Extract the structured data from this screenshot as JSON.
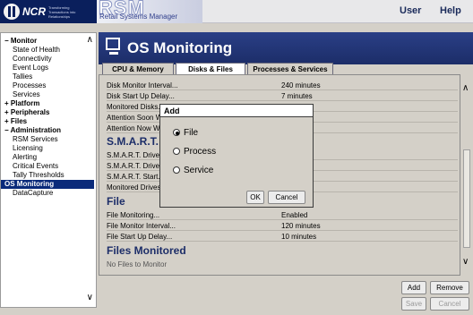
{
  "header": {
    "logo_text": "NCR",
    "logo_tagline": "Transforming Transactions into Relationships",
    "product_short": "RSM",
    "product_name": "Retail Systems Manager",
    "user_link": "User",
    "help_link": "Help"
  },
  "sidebar": {
    "items": [
      {
        "label": "− Monitor",
        "kind": "section"
      },
      {
        "label": "State of Health",
        "kind": "sub"
      },
      {
        "label": "Connectivity",
        "kind": "sub"
      },
      {
        "label": "Event Logs",
        "kind": "sub"
      },
      {
        "label": "Tallies",
        "kind": "sub"
      },
      {
        "label": "Processes",
        "kind": "sub"
      },
      {
        "label": "Services",
        "kind": "sub"
      },
      {
        "label": "+ Platform",
        "kind": "section"
      },
      {
        "label": "+ Peripherals",
        "kind": "section"
      },
      {
        "label": "+ Files",
        "kind": "section"
      },
      {
        "label": "− Administration",
        "kind": "section"
      },
      {
        "label": "RSM Services",
        "kind": "sub"
      },
      {
        "label": "Licensing",
        "kind": "sub"
      },
      {
        "label": "Alerting",
        "kind": "sub"
      },
      {
        "label": "Critical Events",
        "kind": "sub"
      },
      {
        "label": "Tally Thresholds",
        "kind": "sub"
      },
      {
        "label": "OS Monitoring",
        "kind": "selected"
      },
      {
        "label": "DataCapture",
        "kind": "sub"
      }
    ]
  },
  "main": {
    "title": "OS Monitoring",
    "tabs": [
      {
        "label": "CPU & Memory"
      },
      {
        "label": "Disks & Files"
      },
      {
        "label": "Processes & Services"
      }
    ],
    "rows_top": [
      {
        "label": "Disk Monitor Interval...",
        "value": "240 minutes"
      },
      {
        "label": "Disk Start Up Delay...",
        "value": "7 minutes"
      },
      {
        "label": "Monitored Disks...",
        "value": ""
      },
      {
        "label": "Attention Soon W...",
        "value": ""
      },
      {
        "label": "Attention Now W...",
        "value": ""
      }
    ],
    "smart_heading": "S.M.A.R.T.",
    "smart_rows": [
      {
        "label": "S.M.A.R.T. Drive...",
        "value": ""
      },
      {
        "label": "S.M.A.R.T. Drive...",
        "value": "es"
      },
      {
        "label": "S.M.A.R.T. Start...",
        "value": ""
      },
      {
        "label": "Monitored Drives...",
        "value": ""
      }
    ],
    "file_heading": "File",
    "file_rows": [
      {
        "label": "File Monitoring...",
        "value": "Enabled"
      },
      {
        "label": "File Monitor Interval...",
        "value": "120 minutes"
      },
      {
        "label": "File Start Up Delay...",
        "value": "10 minutes"
      }
    ],
    "files_monitored_heading": "Files Monitored",
    "no_files_text": "No Files to Monitor"
  },
  "buttons": {
    "add": "Add",
    "remove": "Remove",
    "save": "Save",
    "cancel": "Cancel"
  },
  "modal": {
    "title": "Add",
    "options": [
      {
        "label": "File",
        "selected": true
      },
      {
        "label": "Process",
        "selected": false
      },
      {
        "label": "Service",
        "selected": false
      }
    ],
    "ok": "OK",
    "cancel": "Cancel"
  }
}
